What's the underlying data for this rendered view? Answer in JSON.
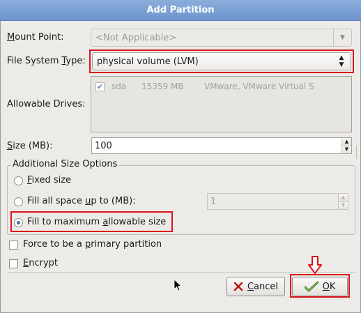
{
  "window": {
    "title": "Add Partition"
  },
  "mount_point": {
    "label_pre": "",
    "label_key": "M",
    "label_post": "ount Point:",
    "value": "<Not Applicable>",
    "enabled": false
  },
  "fs_type": {
    "label_pre": "File System ",
    "label_key": "T",
    "label_post": "ype:",
    "value": "physical volume (LVM)"
  },
  "drives": {
    "label": "Allowable Drives:",
    "rows": [
      {
        "checked": true,
        "name": "sda",
        "size": "15359 MB",
        "model": "VMware, VMware Virtual S"
      }
    ]
  },
  "size": {
    "label_pre": "",
    "label_key": "S",
    "label_post": "ize (MB):",
    "value": "100"
  },
  "size_options": {
    "title": "Additional Size Options",
    "fixed": {
      "pre": "",
      "key": "F",
      "post": "ixed size",
      "selected": false
    },
    "fill_upto": {
      "pre": "Fill all space ",
      "key": "u",
      "post": "p to (MB):",
      "selected": false,
      "value": "1"
    },
    "fill_max": {
      "pre": "Fill to maximum ",
      "key": "a",
      "post": "llowable size",
      "selected": true
    }
  },
  "primary": {
    "pre": "Force to be a ",
    "key": "p",
    "post": "rimary partition",
    "checked": false
  },
  "encrypt": {
    "pre": "",
    "key": "E",
    "post": "ncrypt",
    "checked": false
  },
  "buttons": {
    "cancel": {
      "pre": "",
      "key": "C",
      "post": "ancel"
    },
    "ok": {
      "pre": "",
      "key": "O",
      "post": "K"
    }
  },
  "colors": {
    "highlight": "#d9141c",
    "title_bar": "#7a9fd4"
  }
}
